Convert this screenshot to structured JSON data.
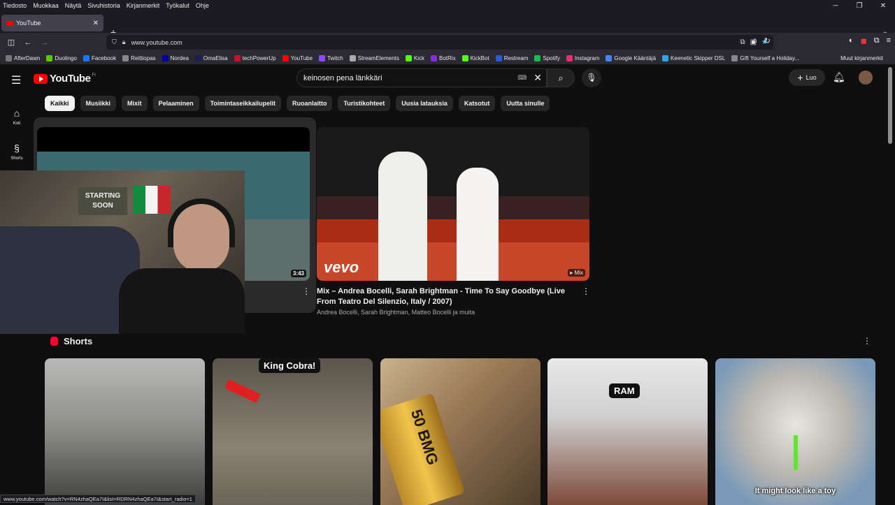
{
  "browser": {
    "menu": [
      "Tiedosto",
      "Muokkaa",
      "Näytä",
      "Sivuhistoria",
      "Kirjanmerkit",
      "Työkalut",
      "Ohje"
    ],
    "tab_title": "YouTube",
    "url": "www.youtube.com",
    "bookmarks": [
      {
        "label": "AfterDawn",
        "color": "#777777"
      },
      {
        "label": "Duolingo",
        "color": "#58cc02"
      },
      {
        "label": "Facebook",
        "color": "#1877f2"
      },
      {
        "label": "Reittiopas",
        "color": "#888888"
      },
      {
        "label": "Nordea",
        "color": "#0000a0"
      },
      {
        "label": "OmaElisa",
        "color": "#1d1d5a"
      },
      {
        "label": "techPowerUp",
        "color": "#c8102e"
      },
      {
        "label": "YouTube",
        "color": "#ff0000"
      },
      {
        "label": "Twitch",
        "color": "#9146ff"
      },
      {
        "label": "StreamElements",
        "color": "#aaaaaa"
      },
      {
        "label": "Kick",
        "color": "#53fc18"
      },
      {
        "label": "BotRix",
        "color": "#8a2be2"
      },
      {
        "label": "KickBot",
        "color": "#53fc18"
      },
      {
        "label": "Restream",
        "color": "#2b5cd6"
      },
      {
        "label": "Spotify",
        "color": "#1db954"
      },
      {
        "label": "Instagram",
        "color": "#e1306c"
      },
      {
        "label": "Google Kääntäjä",
        "color": "#4285f4"
      },
      {
        "label": "Keenetic Skipper DSL",
        "color": "#2aa7e0"
      },
      {
        "label": "Gift Yourself a Holiday...",
        "color": "#888888"
      }
    ],
    "bookmarks_other": "Muut kirjanmerkit",
    "status_url": "www.youtube.com/watch?v=RN4zhaQEa7I&list=RDRN4zhaQEa7I&start_radio=1"
  },
  "youtube": {
    "logo_text": "YouTube",
    "region": "FI",
    "search_value": "keinosen pena länkkäri",
    "create_label": "Luo",
    "sidebar": [
      {
        "label": "Koti",
        "icon": "home-icon"
      },
      {
        "label": "Shorts",
        "icon": "shorts-icon"
      }
    ],
    "chips": [
      "Kaikki",
      "Musiikki",
      "Mixit",
      "Pelaaminen",
      "Toimintaseikkailupelit",
      "Ruoanlaitto",
      "Turistikohteet",
      "Uusia latauksia",
      "Katsotut",
      "Uutta sinulle"
    ],
    "video1": {
      "duration": "3:43"
    },
    "video2": {
      "title": "Mix – Andrea Bocelli, Sarah Brightman - Time To Say Goodbye (Live From Teatro Del Silenzio, Italy / 2007)",
      "meta": "Andrea Bocelli, Sarah Brightman, Matteo Bocelli ja muita",
      "badge": "Mix",
      "watermark": "vevo"
    },
    "webcam_sign": "STARTING SOON",
    "shorts_title": "Shorts",
    "shorts": [
      {
        "caption": "",
        "subtitle": ""
      },
      {
        "caption": "King Cobra!",
        "subtitle": ""
      },
      {
        "caption": "",
        "subtitle": "",
        "print": "50 BMG"
      },
      {
        "caption": "RAM",
        "subtitle": ""
      },
      {
        "caption": "",
        "subtitle": "It might look like a toy"
      }
    ]
  }
}
